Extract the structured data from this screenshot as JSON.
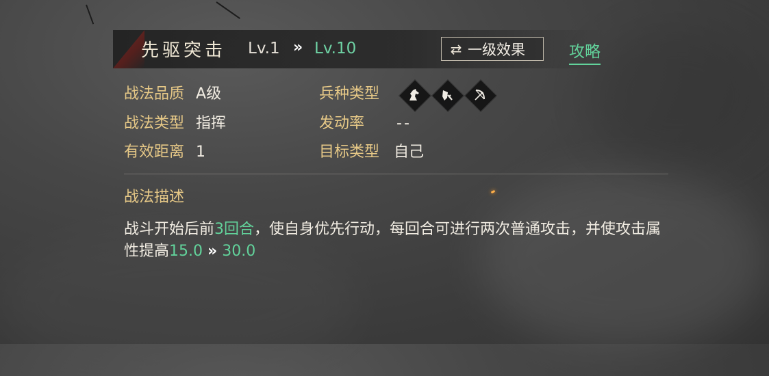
{
  "skill": {
    "name": "先驱突击",
    "level_current": "Lv.1",
    "level_arrow": "»",
    "level_max": "Lv.10"
  },
  "header": {
    "effect_button_icon": "swap-arrows-icon",
    "effect_button_label": "一级效果",
    "guide_label": "攻略"
  },
  "attributes": {
    "quality_label": "战法品质",
    "quality_value": "A级",
    "type_label": "战法类型",
    "type_value": "指挥",
    "range_label": "有效距离",
    "range_value": "1",
    "troop_label": "兵种类型",
    "troop_icons": [
      "cavalry-horse-icon",
      "shield-infantry-icon",
      "bow-archer-icon"
    ],
    "trigger_label": "发动率",
    "trigger_value": "--",
    "target_label": "目标类型",
    "target_value": "自己"
  },
  "description": {
    "title": "战法描述",
    "part1": "战斗开始后前",
    "highlight1": "3回合",
    "part2": "，使自身优先行动，每回合可进行两次普通攻击，并使攻击属性提高",
    "highlight2": "15.0",
    "arrow": "»",
    "highlight3": "30.0"
  },
  "colors": {
    "label_gold": "#e7c987",
    "highlight_green": "#62d39b",
    "accent_red": "#7a2b27"
  }
}
